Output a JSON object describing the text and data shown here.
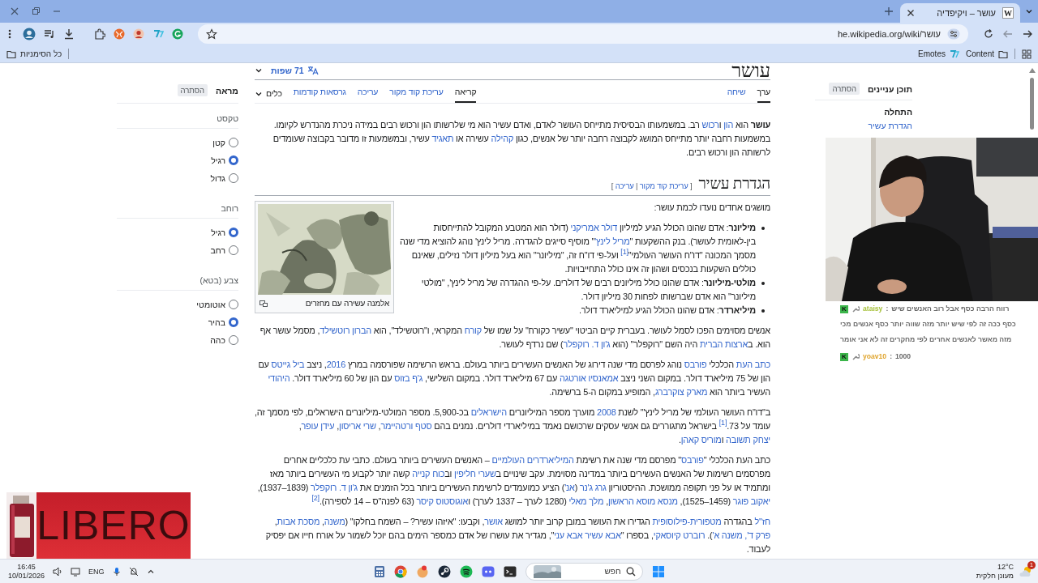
{
  "browser": {
    "tabs": [
      {
        "favicon": "W",
        "title": "עושר – ויקיפדיה",
        "selected": true
      }
    ],
    "url": "he.wikipedia.org/wiki/עושר",
    "bookmarks": [
      {
        "label": "Content",
        "kind": "folder"
      },
      {
        "label": "Emotes",
        "kind": "extension"
      }
    ],
    "all_bookmarks": "כל הסימניות"
  },
  "appearance": {
    "title": "מראה",
    "hide": "הסתרה",
    "sections": [
      {
        "label": "טקסט",
        "options": [
          {
            "label": "קטן",
            "selected": false
          },
          {
            "label": "רגיל",
            "selected": true
          },
          {
            "label": "גדול",
            "selected": false
          }
        ]
      },
      {
        "label": "רוחב",
        "options": [
          {
            "label": "רגיל",
            "selected": true
          },
          {
            "label": "רחב",
            "selected": false
          }
        ]
      },
      {
        "label": "צבע (בטא)",
        "options": [
          {
            "label": "אוטומטי",
            "selected": false
          },
          {
            "label": "בהיר",
            "selected": true
          },
          {
            "label": "כהה",
            "selected": false
          }
        ]
      }
    ]
  },
  "article": {
    "title": "עושר",
    "languages": "71 שפות",
    "namespace_tabs": [
      {
        "label": "ערך",
        "selected": true
      },
      {
        "label": "שיחה",
        "selected": false
      }
    ],
    "view_tabs": [
      {
        "label": "קריאה",
        "selected": true
      },
      {
        "label": "עריכת קוד מקור",
        "selected": false
      },
      {
        "label": "עריכה",
        "selected": false
      },
      {
        "label": "גרסאות קודמות",
        "selected": false
      }
    ],
    "tools": "כלים",
    "blocks": [
      {
        "kind": "paragraph",
        "segments": [
          {
            "kind": "bold",
            "text": "עושר"
          },
          {
            "kind": "text",
            "text": " הוא "
          },
          {
            "kind": "link",
            "text": "הון"
          },
          {
            "kind": "text",
            "text": " ו"
          },
          {
            "kind": "link",
            "text": "רכוש"
          },
          {
            "kind": "text",
            "text": " רב. במשמעותו הבסיסית מתייחס העושר לאדם, ואדם עשיר הוא מי שלרשותו הון ורכוש רבים במידה ניכרת מהנדרש לקיומו. במשמעות רחבה יותר מתייחס המושג לקבוצה רחבה יותר של אנשים, כגון "
          },
          {
            "kind": "link",
            "text": "קהילה"
          },
          {
            "kind": "text",
            "text": " עשירה או "
          },
          {
            "kind": "link",
            "text": "תאגיד"
          },
          {
            "kind": "text",
            "text": " עשיר, ובמשמעות זו מדובר בקבוצה שעומדים לרשותה הון ורכוש רבים."
          }
        ]
      },
      {
        "kind": "heading",
        "text": "הגדרת עשיר",
        "edit_segments": [
          {
            "kind": "text",
            "text": "[ "
          },
          {
            "kind": "link",
            "text": "עריכת קוד מקור"
          },
          {
            "kind": "text",
            "text": " | "
          },
          {
            "kind": "link",
            "text": "עריכה"
          },
          {
            "kind": "text",
            "text": " ]"
          }
        ]
      },
      {
        "kind": "paragraph",
        "segments": [
          {
            "kind": "text",
            "text": "מושגים אחדים נועדו לכמת עושר:"
          }
        ]
      },
      {
        "kind": "list",
        "items": [
          {
            "segments": [
              {
                "kind": "bold",
                "text": "מיליונר"
              },
              {
                "kind": "text",
                "text": ": אדם שהונו הכולל הגיע למיליון "
              },
              {
                "kind": "link",
                "text": "דולר אמריקני"
              },
              {
                "kind": "text",
                "text": " (דולר הוא המטבע המקובל להתייחסות בין-לאומית לעושר). בנק ההשקעות \""
              },
              {
                "kind": "link",
                "text": "מריל לינץ'"
              },
              {
                "kind": "text",
                "text": "\" מוסיף סייגים להגדרה. מריל לינץ' נוהג להוציא מדי שנה מסמך המכונה \"דו\"ח העושר העולמי\""
              },
              {
                "kind": "ref",
                "text": "[1]"
              },
              {
                "kind": "text",
                "text": " ועל-פי דו\"ח זה, \"מיליונר\" הוא בעל מיליון דולר נזילים, שאינם כוללים השקעות בנכסים ושהון זה אינו כולל התחייבויות."
              }
            ]
          },
          {
            "segments": [
              {
                "kind": "bold",
                "text": "מולטי-מיליונר"
              },
              {
                "kind": "text",
                "text": ": אדם שהונו כולל מיליונים רבים של דולרים. על-פי ההגדרה של מריל לינץ', \"מולטי מיליונר\" הוא אדם שברשותו לפחות 30 מיליון דולר."
              }
            ]
          },
          {
            "segments": [
              {
                "kind": "bold",
                "text": "מיליארדר"
              },
              {
                "kind": "text",
                "text": ": אדם שהונו הכולל הגיע למיליארד דולר."
              }
            ]
          }
        ]
      },
      {
        "kind": "figure",
        "caption": "אלמנה עשירה עם מחזרים"
      },
      {
        "kind": "paragraph",
        "segments": [
          {
            "kind": "text",
            "text": "אנשים מסוימים הפכו לסמל לעושר. בעברית קיים הביטוי \"עשיר כקורח\" על שמו של "
          },
          {
            "kind": "link",
            "text": "קורח"
          },
          {
            "kind": "text",
            "text": " המקראי, ו\"רוטשילד\", הוא "
          },
          {
            "kind": "link",
            "text": "הברון רוטשילד"
          },
          {
            "kind": "text",
            "text": ", מסמל עושר אף הוא. ב"
          },
          {
            "kind": "link",
            "text": "ארצות הברית"
          },
          {
            "kind": "text",
            "text": " היה השם \"רוקפלר\" (הוא "
          },
          {
            "kind": "link",
            "text": "ג'ון ד. רוקפלר"
          },
          {
            "kind": "text",
            "text": ") שם נרדף לעושר."
          }
        ]
      },
      {
        "kind": "paragraph",
        "segments": [
          {
            "kind": "link",
            "text": "כתב העת"
          },
          {
            "kind": "text",
            "text": " הכלכלי "
          },
          {
            "kind": "link",
            "text": "פורבס"
          },
          {
            "kind": "text",
            "text": " נוהג לפרסם מדי שנה דירוג של האנשים העשירים ביותר בעולם. בראש הרשימה שפורסמה במרץ "
          },
          {
            "kind": "link",
            "text": "2016"
          },
          {
            "kind": "text",
            "text": ", ניצב "
          },
          {
            "kind": "link",
            "text": "ביל גייטס"
          },
          {
            "kind": "text",
            "text": " עם הון של 75 מיליארד דולר. במקום השני ניצב "
          },
          {
            "kind": "link",
            "text": "אמאנסיו אורטגה"
          },
          {
            "kind": "text",
            "text": " עם 67 מיליארד דולר. במקום השלישי, "
          },
          {
            "kind": "link",
            "text": "ג'ף בזוס"
          },
          {
            "kind": "text",
            "text": " עם הון של 60 מיליארד דולר. "
          },
          {
            "kind": "link",
            "text": "היהודי"
          },
          {
            "kind": "text",
            "text": " העשיר ביותר הוא "
          },
          {
            "kind": "link",
            "text": "מארק צוקרברג"
          },
          {
            "kind": "text",
            "text": ", המופיע במקום ה-5 ברשימה."
          }
        ]
      },
      {
        "kind": "paragraph",
        "segments": [
          {
            "kind": "text",
            "text": "ב\"דו\"ח העושר העולמי של מריל לינץ'\" לשנת "
          },
          {
            "kind": "link",
            "text": "2008"
          },
          {
            "kind": "text",
            "text": " מוערך מספר המיליונרים "
          },
          {
            "kind": "link",
            "text": "הישראלים"
          },
          {
            "kind": "text",
            "text": " בכ-5,900. מספר המולטי-מיליונרים הישראלים, לפי מסמך זה, עומד על 73."
          },
          {
            "kind": "ref",
            "text": "[1]"
          },
          {
            "kind": "text",
            "text": " בישראל מתגוררים גם אנשי עסקים שרכושם נאמד במיליארדי דולרים. נמנים בהם "
          },
          {
            "kind": "link",
            "text": "סטף ורטהיימר"
          },
          {
            "kind": "text",
            "text": ", "
          },
          {
            "kind": "link",
            "text": "שרי אריסון"
          },
          {
            "kind": "text",
            "text": ", "
          },
          {
            "kind": "link",
            "text": "עידן עופר"
          },
          {
            "kind": "text",
            "text": ", "
          },
          {
            "kind": "link",
            "text": "יצחק תשובה"
          },
          {
            "kind": "text",
            "text": " ו"
          },
          {
            "kind": "link",
            "text": "מוריס קאהן"
          },
          {
            "kind": "text",
            "text": "."
          }
        ]
      },
      {
        "kind": "paragraph",
        "segments": [
          {
            "kind": "text",
            "text": "כתב העת הכלכלי \""
          },
          {
            "kind": "link",
            "text": "פורבס"
          },
          {
            "kind": "text",
            "text": "\" מפרסם מדי שנה את רשימת "
          },
          {
            "kind": "link",
            "text": "המיליארדרים העולמיים"
          },
          {
            "kind": "text",
            "text": " – האנשים העשירים ביותר בעולם. כתבי עת כלכליים אחרים מפרסמים רשימות של האנשים העשירים ביותר במדינה מסוימת. עקב שינויים ב"
          },
          {
            "kind": "link",
            "text": "שערי חליפין"
          },
          {
            "kind": "text",
            "text": " וב"
          },
          {
            "kind": "link",
            "text": "כוח קנייה"
          },
          {
            "kind": "text",
            "text": " קשה יותר לקבוע מי העשירים ביותר מאז ומתמיד או על פני תקופה ממושכת. ההיסטוריון "
          },
          {
            "kind": "link",
            "text": "גרג ג'נר"
          },
          {
            "kind": "text",
            "text": " ("
          },
          {
            "kind": "link",
            "text": "אנ'"
          },
          {
            "kind": "text",
            "text": ") הציע כמועמדים לרשימת העשירים ביותר בכל הזמנים את "
          },
          {
            "kind": "link",
            "text": "ג'ון ד. רוקפלר"
          },
          {
            "kind": "text",
            "text": " (1839–1937), "
          },
          {
            "kind": "link",
            "text": "יאקוב פוגר"
          },
          {
            "kind": "text",
            "text": " (1459–1525), "
          },
          {
            "kind": "link",
            "text": "מנסא מוסא הראשון"
          },
          {
            "kind": "text",
            "text": ", "
          },
          {
            "kind": "link",
            "text": "מלך מאלי"
          },
          {
            "kind": "text",
            "text": " (1280 לערך – 1337 לערך) ו"
          },
          {
            "kind": "link",
            "text": "אוגוסטוס קיסר"
          },
          {
            "kind": "text",
            "text": " (63 לפנה\"ס – 14 לספירה)."
          },
          {
            "kind": "ref",
            "text": "[2]"
          }
        ]
      },
      {
        "kind": "paragraph",
        "segments": [
          {
            "kind": "link",
            "text": "חז\"ל"
          },
          {
            "kind": "text",
            "text": " בהגדרה "
          },
          {
            "kind": "link",
            "text": "מטפורית-פילוסופית"
          },
          {
            "kind": "text",
            "text": " הגדירו את העושר במובן קרוב יותר למושג "
          },
          {
            "kind": "link",
            "text": "אושר"
          },
          {
            "kind": "text",
            "text": ", וקבעו: \"איזהו עשיר? – השמח בחלקו\" ("
          },
          {
            "kind": "link",
            "text": "משנה"
          },
          {
            "kind": "text",
            "text": ", "
          },
          {
            "kind": "link",
            "text": "מסכת אבות"
          },
          {
            "kind": "text",
            "text": ", "
          },
          {
            "kind": "link",
            "text": "פרק ד', משנה א'"
          },
          {
            "kind": "text",
            "text": "). "
          },
          {
            "kind": "link",
            "text": "רוברט קיוסאקי"
          },
          {
            "kind": "text",
            "text": ", בספרו \""
          },
          {
            "kind": "link",
            "text": "אבא עשיר אבא עני"
          },
          {
            "kind": "text",
            "text": "\", מגדיר את עושרו של אדם כמספר הימים בהם יוכל לשמור על אורח חייו אם יפסיק לעבוד."
          }
        ]
      }
    ]
  },
  "toc": {
    "title": "תוכן עניינים",
    "hide": "הסתרה",
    "items": [
      {
        "label": "התחלה",
        "selected": true
      },
      {
        "label": "הגדרת עשיר",
        "selected": false
      }
    ]
  },
  "stream": {
    "chat": [
      {
        "badge": "K",
        "user": "ataisy",
        "color": "#a6c13a",
        "separator": ":",
        "lines": [
          "רווח הרבה כסף אבל רוב האנשים שיש",
          "כסף ככה זה לפי שיש יותר מזה שווה יותר כסף אנשים מכי",
          "מזה מאשר לאנשים אחרים לפי מחקרים זה לא אני אומר"
        ]
      },
      {
        "badge": "K",
        "user": "yoav10",
        "color": "#e0a52e",
        "separator": ":",
        "lines": [
          "1000"
        ]
      }
    ]
  },
  "ad": {
    "brand": "LIBERO"
  },
  "taskbar": {
    "time": "16:45",
    "date": "10/01/2026",
    "language": "ENG",
    "search": {
      "placeholder": "חפש"
    },
    "weather": {
      "temperature": "12°C",
      "condition": "מעונן חלקית",
      "badge": "1"
    }
  }
}
